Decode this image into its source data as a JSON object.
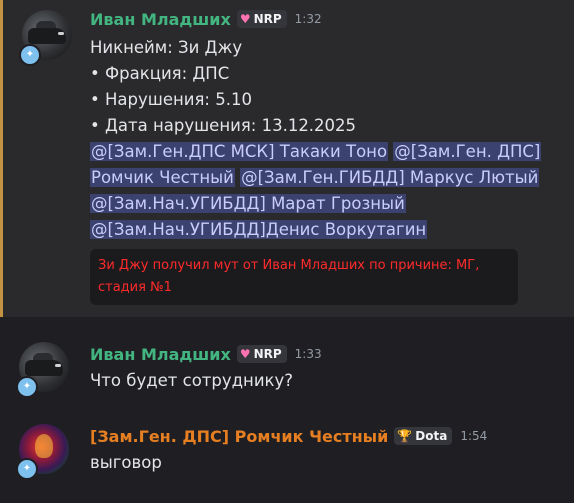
{
  "messages": [
    {
      "author": "Иван Младших",
      "tag": "NRP",
      "tag_icon": "heart-icon",
      "time": "1:32",
      "lines": [
        "Никнейм: Зи Джу",
        "• Фракция: ДПС",
        "• Нарушения: 5.10",
        "• Дата нарушения: 13.12.2025"
      ],
      "mentions": [
        "@[Зам.Ген.ДПС МСК] Такаки Тоно",
        "@[Зам.Ген. ДПС] Ромчик Честный",
        "@[Зам.Ген.ГИБДД] Маркус Лютый",
        "@[Зам.Нач.УГИБДД] Марат Грозный",
        "@[Зам.Нач.УГИБДД]Денис Воркутагин"
      ],
      "bot_notice": "Зи Джу получил мут от Иван Младших по причине: МГ, стадия №1"
    },
    {
      "author": "Иван Младших",
      "tag": "NRP",
      "tag_icon": "heart-icon",
      "time": "1:33",
      "text": "Что будет сотруднику?"
    },
    {
      "author": "[Зам.Ген. ДПС] Ромчик Честный",
      "tag": "Dota",
      "tag_icon": "trophy-icon",
      "time": "1:54",
      "text": "выговор"
    }
  ],
  "colors": {
    "highlight_bg": "#2a2a2d",
    "highlight_border": "#c39242",
    "name_green": "#43b581",
    "name_orange": "#e67e22",
    "mention_bg": "#3c4270",
    "bot_text": "#ff2a2a"
  }
}
